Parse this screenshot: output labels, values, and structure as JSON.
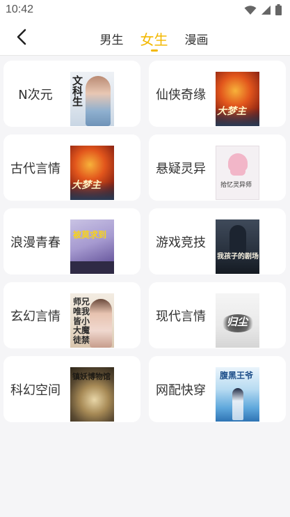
{
  "status_bar": {
    "time": "10:42",
    "icons": [
      "wifi-icon",
      "signal-icon",
      "battery-icon"
    ]
  },
  "header": {
    "back_icon": "chevron-left-icon",
    "tabs": [
      {
        "label": "男生",
        "active": false
      },
      {
        "label": "女生",
        "active": true
      },
      {
        "label": "漫画",
        "active": false
      }
    ]
  },
  "theme": {
    "accent": "#f3b800",
    "background": "#f5f5f7",
    "card": "#ffffff"
  },
  "categories": [
    {
      "label": "N次元",
      "cover_title": "文科生"
    },
    {
      "label": "仙侠奇缘",
      "cover_title": "大梦主"
    },
    {
      "label": "古代言情",
      "cover_title": "大梦主"
    },
    {
      "label": "悬疑灵异",
      "cover_title": "拾忆灵异师"
    },
    {
      "label": "浪漫青春",
      "cover_title": "被莫求到"
    },
    {
      "label": "游戏竞技",
      "cover_title": "我孩子的剧场"
    },
    {
      "label": "玄幻言情",
      "cover_title": "师兄唯我皆小大魔徒禁"
    },
    {
      "label": "现代言情",
      "cover_title": "归尘"
    },
    {
      "label": "科幻空间",
      "cover_title": "镇妖博物馆"
    },
    {
      "label": "网配快穿",
      "cover_title": "腹黑王爷"
    }
  ]
}
